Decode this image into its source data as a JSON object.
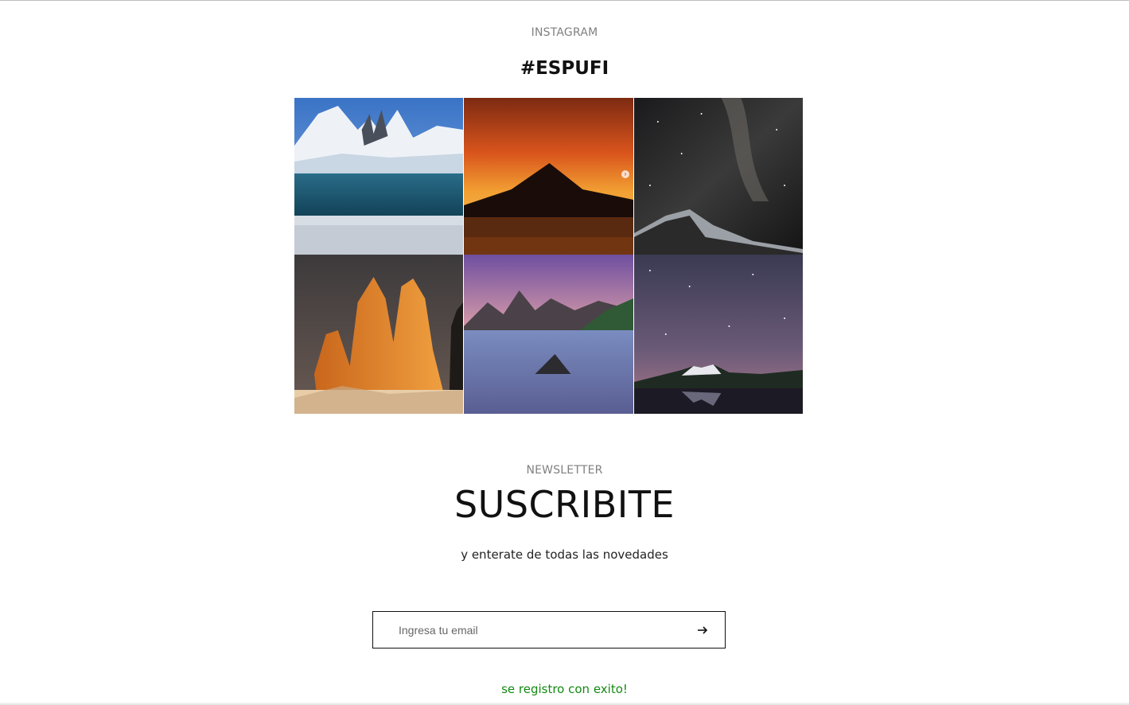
{
  "instagram": {
    "kicker": "INSTAGRAM",
    "hashtag": "#ESPUFI",
    "posts": [
      {
        "label": "Snowy mountains with frozen lake"
      },
      {
        "label": "Volcano silhouette at orange sunset"
      },
      {
        "label": "Milky way over dark mountain"
      },
      {
        "label": "Granite towers at golden light"
      },
      {
        "label": "Peaks over misty lake with purple clouds"
      },
      {
        "label": "Starry sky over mountains reflected in lake"
      }
    ]
  },
  "newsletter": {
    "kicker": "NEWSLETTER",
    "title": "SUSCRIBITE",
    "subtitle": "y enterate de todas las novedades",
    "email_placeholder": "Ingresa tu email",
    "email_value": "",
    "submit_icon": "arrow-right-icon",
    "success_message": "se registro con exito!"
  },
  "colors": {
    "success": "#138a13",
    "border": "#111111",
    "muted": "#808080"
  }
}
